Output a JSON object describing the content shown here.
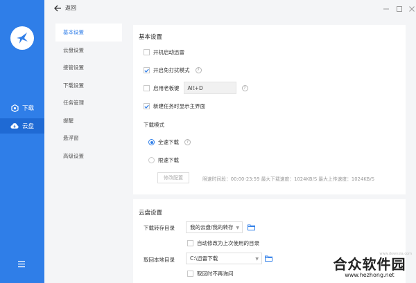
{
  "sidebar": {
    "items": [
      {
        "label": "下载",
        "icon": "download-icon"
      },
      {
        "label": "云盘",
        "icon": "cloud-icon",
        "active": true
      }
    ]
  },
  "topbar": {
    "back_label": "返回"
  },
  "subnav": {
    "items": [
      "基本设置",
      "云盘设置",
      "接管设置",
      "下载设置",
      "任务管理",
      "提醒",
      "悬浮窗",
      "高级设置"
    ],
    "active_index": 0
  },
  "basic": {
    "title": "基本设置",
    "autostart": {
      "label": "开机启动迅雷",
      "checked": false
    },
    "no_disturb": {
      "label": "开启免打扰模式",
      "checked": true
    },
    "boss_key": {
      "label": "启用老板键",
      "checked": false,
      "value": "Alt+D"
    },
    "show_main": {
      "label": "新建任务时显示主界面",
      "checked": true
    },
    "download_mode": {
      "title": "下载模式",
      "full_speed": "全速下载",
      "limited_speed": "限速下载",
      "selected": "全速下载",
      "edit_button": "修改配置",
      "limits_text": "限速时间段：00:00-23:59  最大下载速度：1024KB/S     最大上传速度：1024KB/S"
    }
  },
  "cloud": {
    "title": "云盘设置",
    "transfer_dir_label": "下载转存目录",
    "transfer_dir_value": "我的云盘/我的转存",
    "auto_modify": {
      "label": "自动修改为上次使用的目录",
      "checked": false
    },
    "local_dir_label": "取回本地目录",
    "local_dir_value": "C:\\迅雷下载",
    "no_ask": {
      "label": "取回时不再询问",
      "checked": false
    }
  },
  "watermark": {
    "main": "合众软件园",
    "url": "www.hezhong.net",
    "small": "www.downxia.com"
  },
  "colors": {
    "accent": "#2f7ee8",
    "sidebar": "#2f7ee8",
    "background": "#f4f5f7"
  }
}
